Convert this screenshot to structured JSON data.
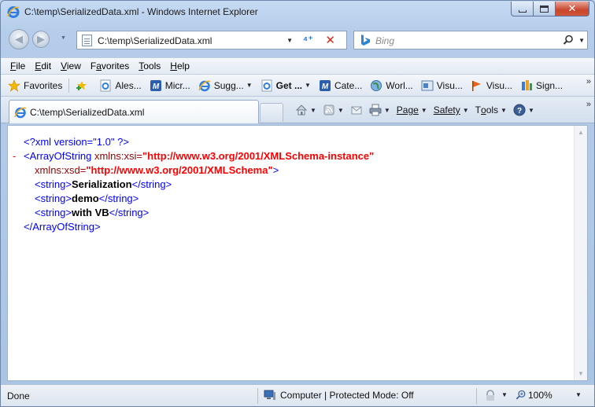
{
  "window": {
    "title": "C:\\temp\\SerializedData.xml - Windows Internet Explorer"
  },
  "address_bar": {
    "url": "C:\\temp\\SerializedData.xml"
  },
  "search": {
    "placeholder": "Bing"
  },
  "menu": {
    "items": [
      {
        "underline": "F",
        "rest": "ile"
      },
      {
        "underline": "E",
        "rest": "dit"
      },
      {
        "underline": "V",
        "rest": "iew"
      },
      {
        "prefix": "F",
        "underline": "a",
        "rest": "vorites"
      },
      {
        "underline": "T",
        "rest": "ools"
      },
      {
        "underline": "H",
        "rest": "elp"
      }
    ]
  },
  "favorites_bar": {
    "favorites_label": "Favorites",
    "links": [
      {
        "label": "Ales...",
        "icon": "ie-page-icon"
      },
      {
        "label": "Micr...",
        "icon": "msdn-icon"
      },
      {
        "label": "Sugg...",
        "icon": "ie-suggested-icon",
        "dropdown": true
      },
      {
        "label": "Get ...",
        "icon": "ie-page-icon",
        "dropdown": true,
        "bold": true
      },
      {
        "label": "Cate...",
        "icon": "msdn-icon"
      },
      {
        "label": "Worl...",
        "icon": "globe-icon"
      },
      {
        "label": "Visu...",
        "icon": "visual-studio-icon"
      },
      {
        "label": "Visu...",
        "icon": "flag-icon"
      },
      {
        "label": "Sign...",
        "icon": "sign-icon"
      }
    ]
  },
  "tab": {
    "label": "C:\\temp\\SerializedData.xml"
  },
  "command_bar": {
    "page_label": "Page",
    "safety_label": "Safety",
    "tools_label_prefix": "T",
    "tools_label_underline": "o",
    "tools_label_rest": "ols"
  },
  "xml": {
    "declaration": "<?xml version=\"1.0\" ?>",
    "collapse_marker": "-",
    "root_open_start": "<ArrayOfString",
    "xsi_attr_name": " xmlns:xsi=",
    "xsi_attr_value": "\"http://www.w3.org/2001/XMLSchema-instance\"",
    "xsd_attr_name": "xmlns:xsd=",
    "xsd_attr_value": "\"http://www.w3.org/2001/XMLSchema\"",
    "open_tag_end": ">",
    "string_open": "<string>",
    "string_close": "</string>",
    "values": [
      "Serialization",
      "demo",
      "with VB"
    ],
    "root_close": "</ArrayOfString>"
  },
  "status_bar": {
    "status": "Done",
    "zone": "Computer | Protected Mode: Off",
    "zoom": "100%"
  }
}
